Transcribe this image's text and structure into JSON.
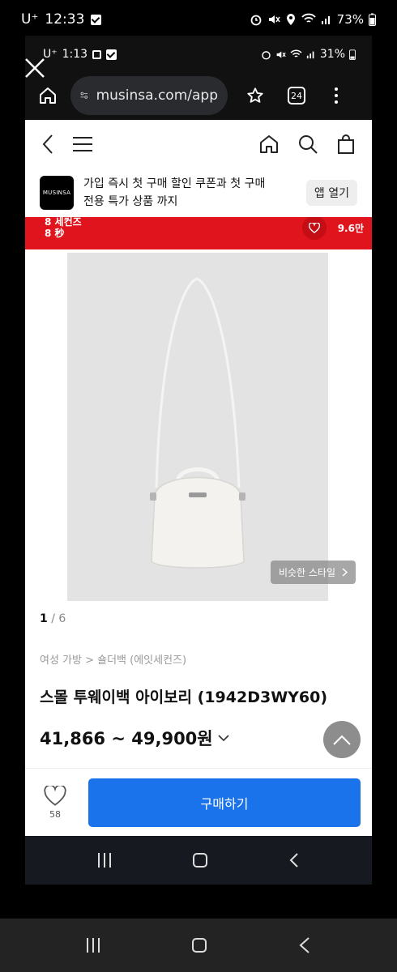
{
  "outer_status": {
    "carrier": "U⁺",
    "time": "12:33",
    "battery": "73%"
  },
  "inner_status": {
    "carrier": "U⁺",
    "time": "1:13",
    "battery": "31%"
  },
  "browser": {
    "url": "musinsa.com/app",
    "tab_count": "24"
  },
  "app_banner": {
    "logo_text": "MUSINSA",
    "message_line1": "가입 즉시 첫 구매 할인 쿠폰과 첫 구매",
    "message_line2": "전용 특가 상품 까지",
    "open_app": "앱 열기"
  },
  "promo": {
    "brand_line1": "8 세컨즈",
    "brand_line2": "8 秒",
    "likes": "9.6만"
  },
  "product": {
    "similar_style": "비슷한 스타일",
    "page_current": "1",
    "page_total": "6",
    "breadcrumb": "여성 가방 > 숄더백 (에잇세컨즈)",
    "title": "스몰 투웨이백 아이보리 (1942D3WY60)",
    "price": "41,866 ~ 49,900원"
  },
  "buy_bar": {
    "like_count": "58",
    "buy_label": "구매하기"
  },
  "colors": {
    "buy_blue": "#1a73ea",
    "promo_red": "#e0141c"
  }
}
